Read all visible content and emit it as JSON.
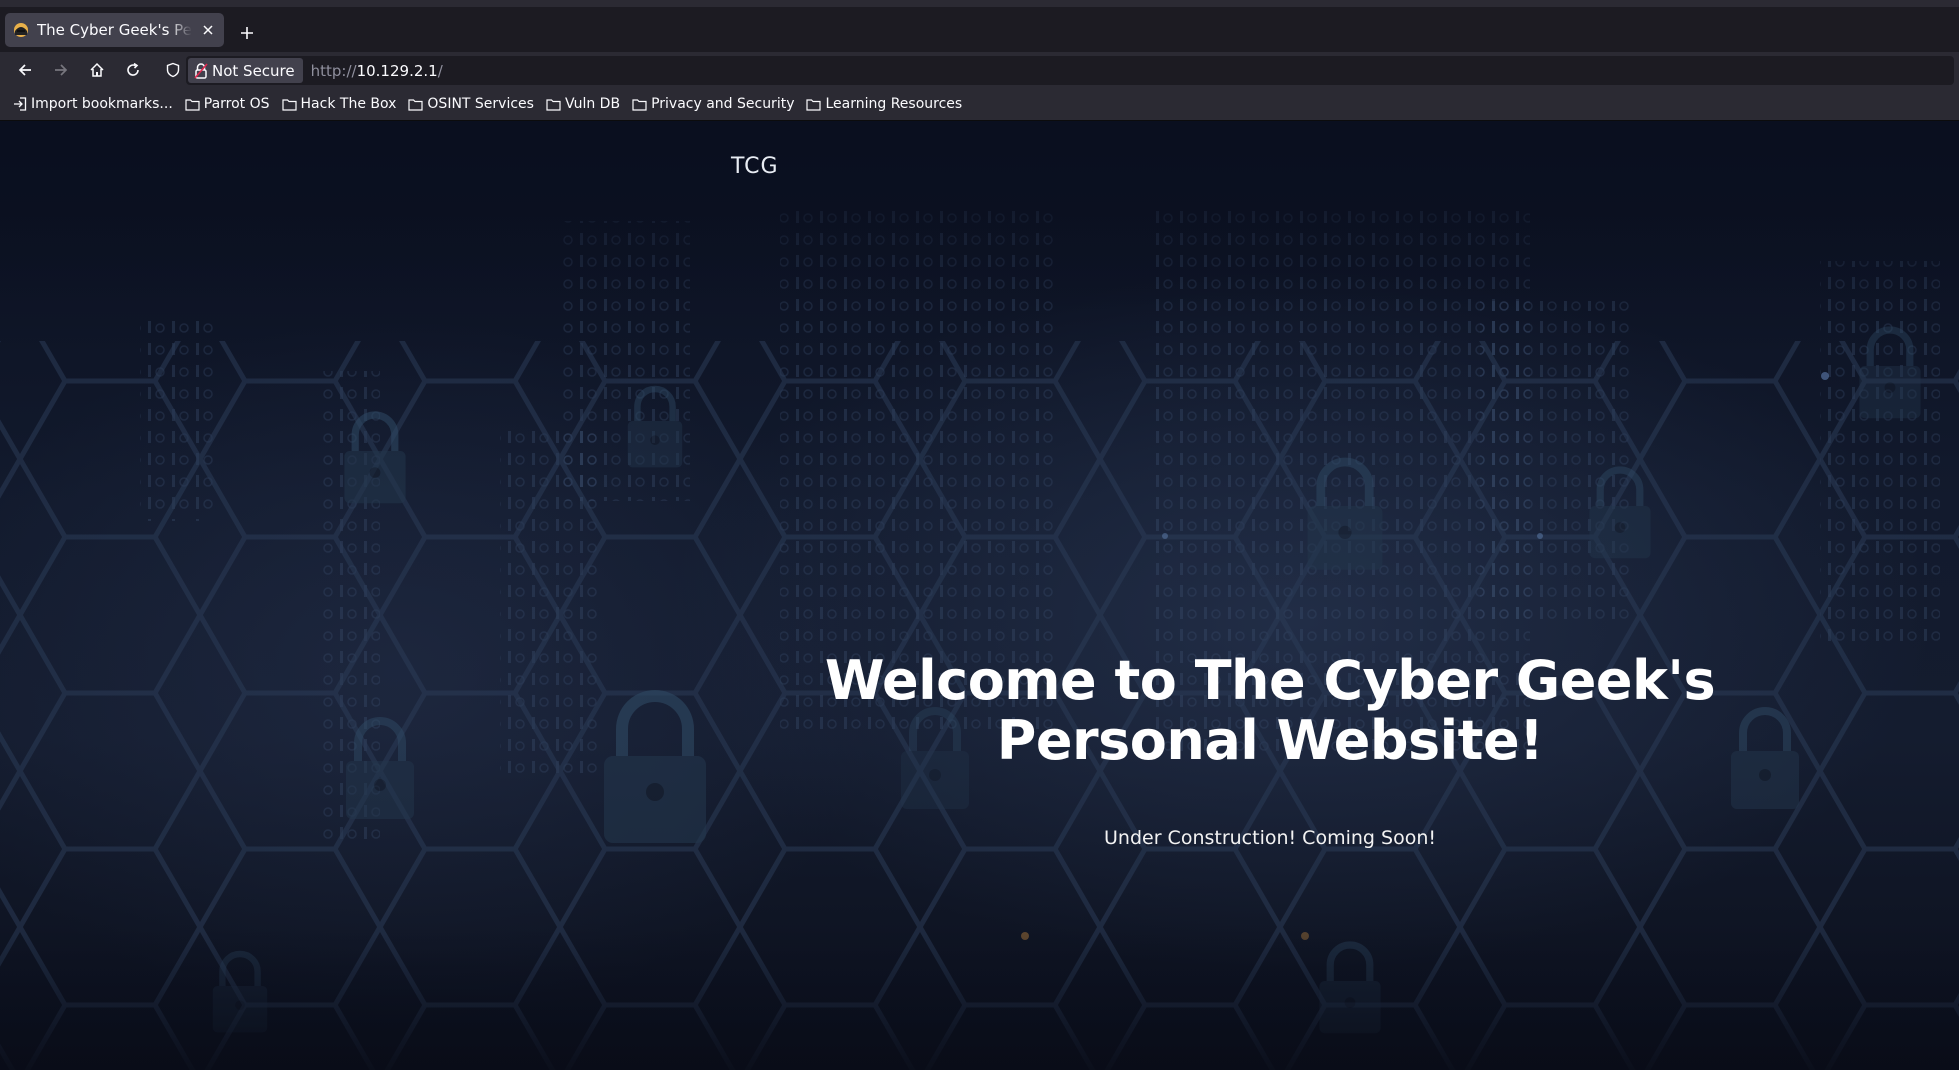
{
  "browser": {
    "tab": {
      "title": "The Cyber Geek's Personal Website"
    },
    "site_identity": {
      "label": "Not Secure"
    },
    "url": {
      "scheme": "http://",
      "host": "10.129.2.1",
      "path": "/"
    },
    "bookmarks": [
      {
        "label": "Import bookmarks...",
        "icon": "import-icon"
      },
      {
        "label": "Parrot OS",
        "icon": "folder-icon"
      },
      {
        "label": "Hack The Box",
        "icon": "folder-icon"
      },
      {
        "label": "OSINT Services",
        "icon": "folder-icon"
      },
      {
        "label": "Vuln DB",
        "icon": "folder-icon"
      },
      {
        "label": "Privacy and Security",
        "icon": "folder-icon"
      },
      {
        "label": "Learning Resources",
        "icon": "folder-icon"
      }
    ]
  },
  "site": {
    "logo": "TCG",
    "hero": {
      "title": "Welcome to The Cyber Geek's Personal Website!",
      "subtitle": "Under Construction! Coming Soon!"
    }
  },
  "colors": {
    "chrome_dark": "#1c1b22",
    "chrome": "#2b2a33",
    "tab_active": "#42414d",
    "page_bg": "#0d1020",
    "not_secure_accent": "#e22850"
  }
}
